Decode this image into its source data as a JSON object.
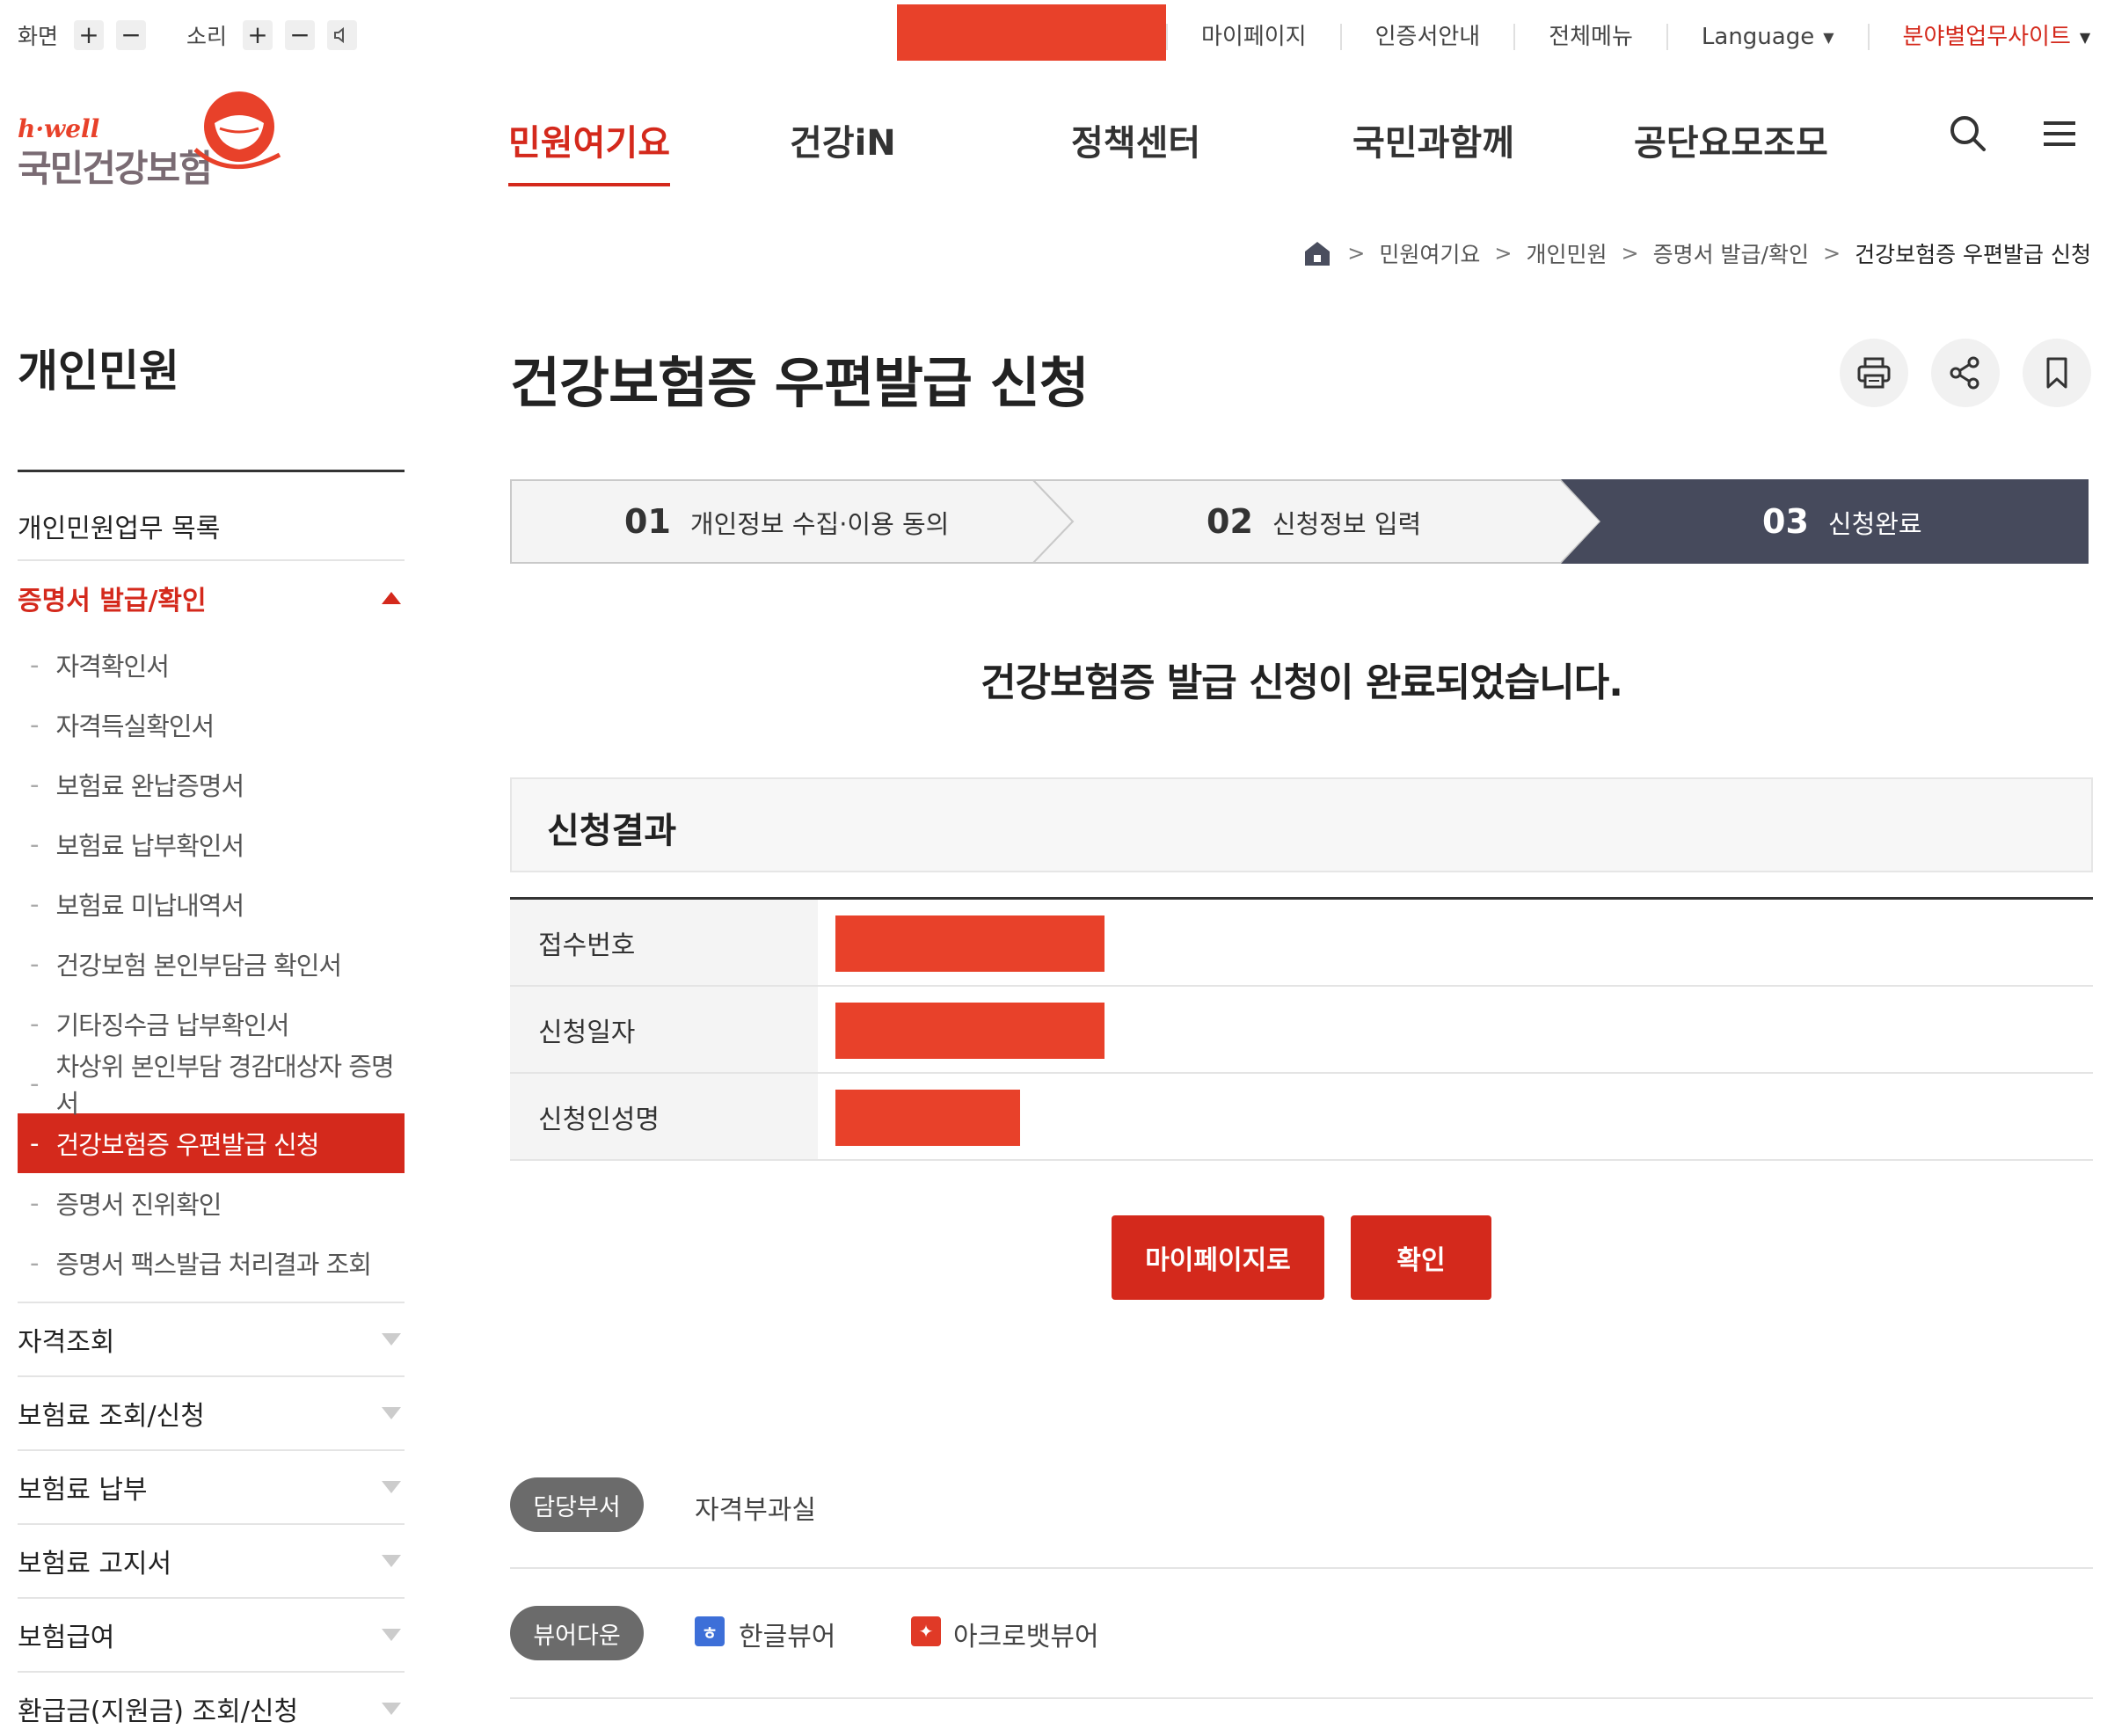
{
  "utility": {
    "screen_label": "화면",
    "sound_label": "소리",
    "plus": "+",
    "minus": "−",
    "links": [
      "마이페이지",
      "인증서안내",
      "전체메뉴",
      "Language",
      "분야별업무사이트"
    ]
  },
  "logo": {
    "small": "h·well",
    "name": "국민건강보험"
  },
  "gnb": {
    "items": [
      "민원여기요",
      "건강iN",
      "정책센터",
      "국민과함께",
      "공단요모조모"
    ],
    "active_index": 0
  },
  "breadcrumb": {
    "items": [
      "민원여기요",
      "개인민원",
      "증명서 발급/확인",
      "건강보험증 우편발급 신청"
    ],
    "separator": ">"
  },
  "sidebar": {
    "title": "개인민원",
    "list_item": "개인민원업무 목록",
    "open_section": "증명서 발급/확인",
    "sub_items": [
      "자격확인서",
      "자격득실확인서",
      "보험료 완납증명서",
      "보험료 납부확인서",
      "보험료 미납내역서",
      "건강보험 본인부담금 확인서",
      "기타징수금 납부확인서",
      "차상위 본인부담 경감대상자 증명서",
      "건강보험증 우편발급 신청",
      "증명서 진위확인",
      "증명서 팩스발급 처리결과 조회"
    ],
    "active_sub_index": 8,
    "dash": "-",
    "collapsed_sections": [
      "자격조회",
      "보험료 조회/신청",
      "보험료 납부",
      "보험료 고지서",
      "보험급여",
      "환급금(지원금) 조회/신청"
    ]
  },
  "main": {
    "title": "건강보험증 우편발급 신청",
    "tools": [
      "print-icon",
      "share-icon",
      "bookmark-icon"
    ],
    "steps": [
      {
        "num": "01",
        "label": "개인정보 수집·이용 동의"
      },
      {
        "num": "02",
        "label": "신청정보 입력"
      },
      {
        "num": "03",
        "label": "신청완료"
      }
    ],
    "current_step": 3,
    "complete_message": "건강보험증 발급 신청이 완료되었습니다.",
    "result_heading": "신청결과",
    "result_rows": [
      "접수번호",
      "신청일자",
      "신청인성명"
    ],
    "buttons": {
      "mypage": "마이페이지로",
      "confirm": "확인"
    },
    "department": {
      "label": "담당부서",
      "value": "자격부과실"
    },
    "viewer": {
      "label": "뷰어다운",
      "hangul": "한글뷰어",
      "acrobat": "아크로뱃뷰어"
    }
  },
  "colors": {
    "accent": "#d4291c",
    "redaction": "#e8412a",
    "step_active": "#464a5c",
    "pill": "#6b6b6b"
  }
}
